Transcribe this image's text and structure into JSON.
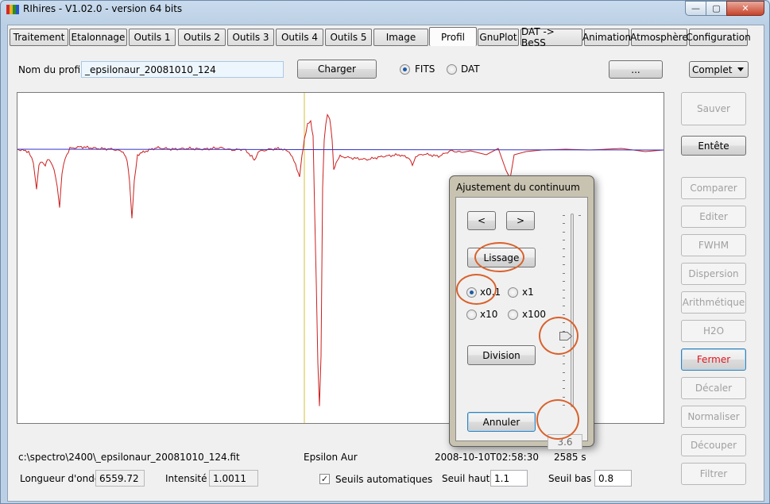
{
  "window": {
    "title": "RIhires - V1.02.0 - version 64 bits",
    "min_glyph": "—",
    "max_glyph": "▢",
    "close_glyph": "✕",
    "icon_colors": [
      "#d12b2b",
      "#e8b21e",
      "#2a8c2a",
      "#2757c4"
    ]
  },
  "tabs": [
    "Traitement",
    "Etalonnage",
    "Outils 1",
    "Outils 2",
    "Outils 3",
    "Outils 4",
    "Outils 5",
    "Image",
    "Profil",
    "GnuPlot",
    "DAT -> BeSS",
    "Animation",
    "Atmosphère",
    "Configuration"
  ],
  "active_tab": "Profil",
  "profile": {
    "name_label": "Nom du profil :",
    "name_value": "_epsilonaur_20081010_124",
    "load_button": "Charger",
    "format_options": [
      "FITS",
      "DAT"
    ],
    "format_selected": "FITS",
    "browse_button": "...",
    "mode_value": "Complet"
  },
  "side_buttons": [
    {
      "label": "Sauver",
      "enabled": false
    },
    {
      "label": "Entête",
      "enabled": true
    },
    {
      "label": "Comparer",
      "enabled": false
    },
    {
      "label": "Editer",
      "enabled": false
    },
    {
      "label": "FWHM",
      "enabled": false
    },
    {
      "label": "Dispersion",
      "enabled": false
    },
    {
      "label": "Arithmétique",
      "enabled": false
    },
    {
      "label": "H2O",
      "enabled": false
    },
    {
      "label": "Fermer",
      "enabled": true,
      "accent": "#e0161e"
    },
    {
      "label": "Décaler",
      "enabled": false
    },
    {
      "label": "Normaliser",
      "enabled": false
    },
    {
      "label": "Découper",
      "enabled": false
    },
    {
      "label": "Filtrer",
      "enabled": false
    }
  ],
  "status": {
    "file_path": "c:\\spectro\\2400\\_epsilonaur_20081010_124.fit",
    "object": "Epsilon Aur",
    "date": "2008-10-10T02:58:30",
    "exposure": "2585 s",
    "wavelength_label": "Longueur d'onde :",
    "wavelength_value": "6559.72",
    "intensity_label": "Intensité :",
    "intensity_value": "1.0011",
    "auto_threshold_label": "Seuils automatiques",
    "auto_threshold_checked": true,
    "high_label": "Seuil haut :",
    "high_value": "1.1",
    "low_label": "Seuil bas :",
    "low_value": "0.8"
  },
  "dialog": {
    "title": "Ajustement du continuum",
    "prev_button": "<",
    "next_button": ">",
    "smooth_button": "Lissage",
    "factor_options": [
      "x0.1",
      "x1",
      "x10",
      "x100"
    ],
    "factor_selected": "x0.1",
    "division_button": "Division",
    "cancel_button": "Annuler",
    "slider_value": "3.6"
  },
  "colors": {
    "profile_line": "#cc1f1f",
    "continuum_line": "#3333cc",
    "cursor_line": "#d7c23a",
    "annotation": "#d9612c"
  }
}
